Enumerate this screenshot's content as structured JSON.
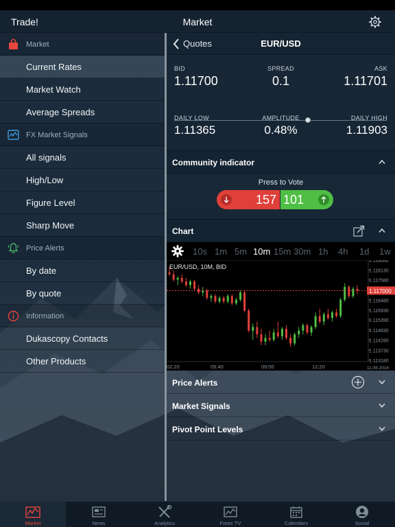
{
  "topbar": {
    "app_title": "Trade!",
    "screen_title": "Market"
  },
  "sidebar": {
    "sections": [
      {
        "header": "Market",
        "icon": "shopping-bag-icon",
        "items": [
          "Current Rates",
          "Market Watch",
          "Average Spreads"
        ]
      },
      {
        "header": "FX Market Signals",
        "icon": "signal-chart-icon",
        "items": [
          "All signals",
          "High/Low",
          "Figure Level",
          "Sharp Move"
        ]
      },
      {
        "header": "Price Alerts",
        "icon": "bell-icon",
        "items": [
          "By date",
          "By quote"
        ]
      },
      {
        "header": "Information",
        "icon": "info-icon",
        "items": [
          "Dukascopy Contacts",
          "Other Products"
        ]
      }
    ],
    "active_item": "Current Rates"
  },
  "quotes": {
    "back_label": "Quotes",
    "pair": "EUR/USD",
    "bid_label": "BID",
    "bid": "1.11700",
    "spread_label": "SPREAD",
    "spread": "0.1",
    "ask_label": "ASK",
    "ask": "1.11701",
    "daily_low_label": "DAILY LOW",
    "daily_low": "1.11365",
    "amplitude_label": "AMPLITUDE",
    "amplitude": "0.48%",
    "daily_high_label": "DAILY HIGH",
    "daily_high": "1.11903",
    "range_position": 0.63
  },
  "community": {
    "title": "Community indicator",
    "prompt": "Press to Vote",
    "down_votes": "157",
    "up_votes": "101"
  },
  "chart_section": {
    "title": "Chart",
    "timeframes": [
      "10s",
      "1m",
      "5m",
      "10m",
      "15m",
      "30m",
      "1h",
      "4h",
      "1d",
      "1w"
    ],
    "active_timeframe": "10m"
  },
  "chart_data": {
    "type": "candlestick",
    "title": "EUR/USD, 10M, BID",
    "current_price": 1.117,
    "current_price_label": "1.117000",
    "ylim": [
      1.1131,
      1.1186
    ],
    "y_ticks": [
      "1.118680",
      "1.118130",
      "1.117580",
      "1.117030",
      "1.116480",
      "1.115930",
      "1.115390",
      "1.114830",
      "1.114280",
      "1.113730",
      "1.113180"
    ],
    "x_ticks": [
      "02:20",
      "05:40",
      "09:00",
      "12:20"
    ],
    "date_label": "11.08.2016",
    "candles": [
      {
        "o": 1.118,
        "h": 1.1183,
        "l": 1.1178,
        "c": 1.1179
      },
      {
        "o": 1.1179,
        "h": 1.1181,
        "l": 1.1175,
        "c": 1.1176
      },
      {
        "o": 1.1176,
        "h": 1.1178,
        "l": 1.1173,
        "c": 1.1177
      },
      {
        "o": 1.1177,
        "h": 1.1179,
        "l": 1.1174,
        "c": 1.1175
      },
      {
        "o": 1.1175,
        "h": 1.1177,
        "l": 1.1172,
        "c": 1.1173
      },
      {
        "o": 1.1173,
        "h": 1.1176,
        "l": 1.1171,
        "c": 1.1175
      },
      {
        "o": 1.1175,
        "h": 1.1176,
        "l": 1.117,
        "c": 1.1171
      },
      {
        "o": 1.1171,
        "h": 1.1173,
        "l": 1.1168,
        "c": 1.1169
      },
      {
        "o": 1.1169,
        "h": 1.1172,
        "l": 1.1167,
        "c": 1.117
      },
      {
        "o": 1.117,
        "h": 1.1171,
        "l": 1.1165,
        "c": 1.1166
      },
      {
        "o": 1.1166,
        "h": 1.1168,
        "l": 1.1164,
        "c": 1.1167
      },
      {
        "o": 1.1167,
        "h": 1.1168,
        "l": 1.1163,
        "c": 1.1164
      },
      {
        "o": 1.1164,
        "h": 1.1167,
        "l": 1.1163,
        "c": 1.1166
      },
      {
        "o": 1.1166,
        "h": 1.1167,
        "l": 1.1163,
        "c": 1.1164
      },
      {
        "o": 1.1164,
        "h": 1.1168,
        "l": 1.1163,
        "c": 1.1167
      },
      {
        "o": 1.1167,
        "h": 1.1168,
        "l": 1.1162,
        "c": 1.1163
      },
      {
        "o": 1.1163,
        "h": 1.1166,
        "l": 1.1162,
        "c": 1.1165
      },
      {
        "o": 1.1165,
        "h": 1.117,
        "l": 1.1164,
        "c": 1.1169
      },
      {
        "o": 1.1169,
        "h": 1.117,
        "l": 1.1158,
        "c": 1.1159
      },
      {
        "o": 1.1159,
        "h": 1.116,
        "l": 1.1147,
        "c": 1.1148
      },
      {
        "o": 1.1148,
        "h": 1.1152,
        "l": 1.1143,
        "c": 1.115
      },
      {
        "o": 1.115,
        "h": 1.1153,
        "l": 1.1144,
        "c": 1.1146
      },
      {
        "o": 1.1146,
        "h": 1.1149,
        "l": 1.114,
        "c": 1.1142
      },
      {
        "o": 1.1142,
        "h": 1.1146,
        "l": 1.114,
        "c": 1.1144
      },
      {
        "o": 1.1144,
        "h": 1.1148,
        "l": 1.1142,
        "c": 1.1143
      },
      {
        "o": 1.1143,
        "h": 1.1149,
        "l": 1.1142,
        "c": 1.1147
      },
      {
        "o": 1.1147,
        "h": 1.1153,
        "l": 1.1144,
        "c": 1.1145
      },
      {
        "o": 1.1145,
        "h": 1.115,
        "l": 1.1143,
        "c": 1.1149
      },
      {
        "o": 1.1149,
        "h": 1.1151,
        "l": 1.1143,
        "c": 1.1144
      },
      {
        "o": 1.1144,
        "h": 1.1146,
        "l": 1.1139,
        "c": 1.1141
      },
      {
        "o": 1.1141,
        "h": 1.1147,
        "l": 1.114,
        "c": 1.1146
      },
      {
        "o": 1.1146,
        "h": 1.115,
        "l": 1.1144,
        "c": 1.1148
      },
      {
        "o": 1.1148,
        "h": 1.1152,
        "l": 1.1146,
        "c": 1.1151
      },
      {
        "o": 1.1151,
        "h": 1.1152,
        "l": 1.1146,
        "c": 1.1147
      },
      {
        "o": 1.1147,
        "h": 1.1151,
        "l": 1.1145,
        "c": 1.115
      },
      {
        "o": 1.115,
        "h": 1.1158,
        "l": 1.1149,
        "c": 1.1156
      },
      {
        "o": 1.1156,
        "h": 1.116,
        "l": 1.1152,
        "c": 1.1153
      },
      {
        "o": 1.1153,
        "h": 1.1158,
        "l": 1.1151,
        "c": 1.1157
      },
      {
        "o": 1.1157,
        "h": 1.116,
        "l": 1.1154,
        "c": 1.1155
      },
      {
        "o": 1.1155,
        "h": 1.1159,
        "l": 1.1153,
        "c": 1.1158
      },
      {
        "o": 1.1158,
        "h": 1.116,
        "l": 1.1155,
        "c": 1.1156
      },
      {
        "o": 1.1156,
        "h": 1.1166,
        "l": 1.1155,
        "c": 1.1165
      },
      {
        "o": 1.1165,
        "h": 1.1174,
        "l": 1.1164,
        "c": 1.1172
      },
      {
        "o": 1.1172,
        "h": 1.1173,
        "l": 1.1166,
        "c": 1.1167
      },
      {
        "o": 1.1167,
        "h": 1.1172,
        "l": 1.1166,
        "c": 1.1171
      },
      {
        "o": 1.1171,
        "h": 1.1173,
        "l": 1.1168,
        "c": 1.117
      }
    ]
  },
  "accordions": {
    "price_alerts": "Price Alerts",
    "market_signals": "Market Signals",
    "pivot_points": "Pivot Point Levels"
  },
  "tabbar": {
    "tabs": [
      "Market",
      "News",
      "Analytics",
      "Forex TV",
      "Calendars",
      "Social"
    ],
    "active": "Market"
  },
  "colors": {
    "accent_red": "#e9463e",
    "vote_red": "#e0403a",
    "vote_green": "#4fbe45",
    "candle_up": "#4fbe45",
    "candle_down": "#e0403a"
  }
}
